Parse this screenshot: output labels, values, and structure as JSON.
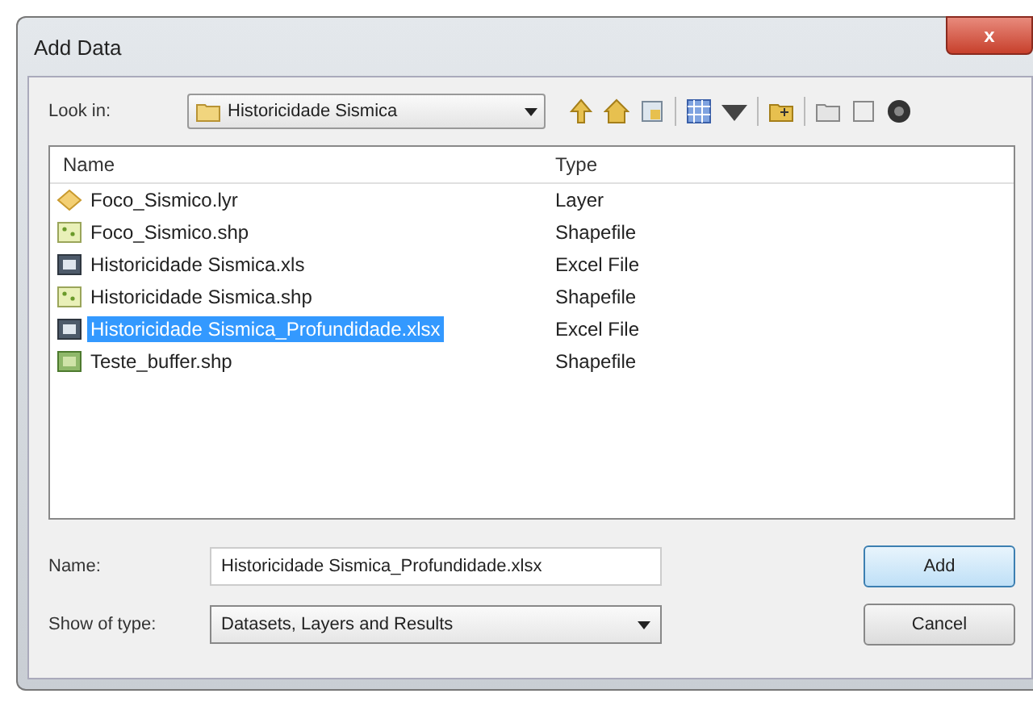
{
  "window": {
    "title": "Add Data",
    "close": "x"
  },
  "look_in": {
    "label": "Look in:",
    "value": "Historicidade Sismica"
  },
  "file_list": {
    "columns": [
      "Name",
      "Type"
    ],
    "rows": [
      {
        "name": "Foco_Sismico.lyr",
        "type": "Layer",
        "kind": "layer",
        "selected": false
      },
      {
        "name": "Foco_Sismico.shp",
        "type": "Shapefile",
        "kind": "shapefile",
        "selected": false
      },
      {
        "name": "Historicidade Sismica.xls",
        "type": "Excel File",
        "kind": "excel",
        "selected": false
      },
      {
        "name": "Historicidade Sismica.shp",
        "type": "Shapefile",
        "kind": "shapefile",
        "selected": false
      },
      {
        "name": "Historicidade Sismica_Profundidade.xlsx",
        "type": "Excel File",
        "kind": "excel",
        "selected": true
      },
      {
        "name": "Teste_buffer.shp",
        "type": "Shapefile",
        "kind": "raster",
        "selected": false
      }
    ]
  },
  "name_field": {
    "label": "Name:",
    "value": "Historicidade Sismica_Profundidade.xlsx"
  },
  "type_field": {
    "label": "Show of type:",
    "value": "Datasets, Layers and Results"
  },
  "buttons": [
    "Add",
    "Cancel"
  ]
}
